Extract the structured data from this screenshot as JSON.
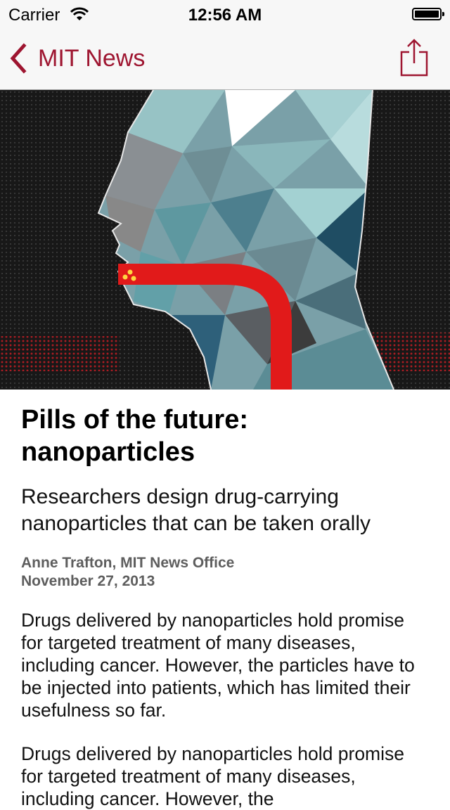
{
  "status_bar": {
    "carrier": "Carrier",
    "time": "12:56 AM"
  },
  "nav": {
    "back_label": "MIT News",
    "accent_color": "#9e1530"
  },
  "article": {
    "title": "Pills of the future: nanoparticles",
    "subtitle": "Researchers design drug-carrying nanoparticles that can be taken orally",
    "author": "Anne Trafton, MIT News Office",
    "date": "November 27, 2013",
    "paragraphs": [
      "Drugs delivered by nanoparticles hold promise for targeted treatment of many diseases, including cancer. However, the particles have to be injected into patients, which has limited their usefulness so far.",
      "Drugs delivered by nanoparticles hold promise for targeted treatment of many diseases, including cancer. However, the"
    ]
  }
}
